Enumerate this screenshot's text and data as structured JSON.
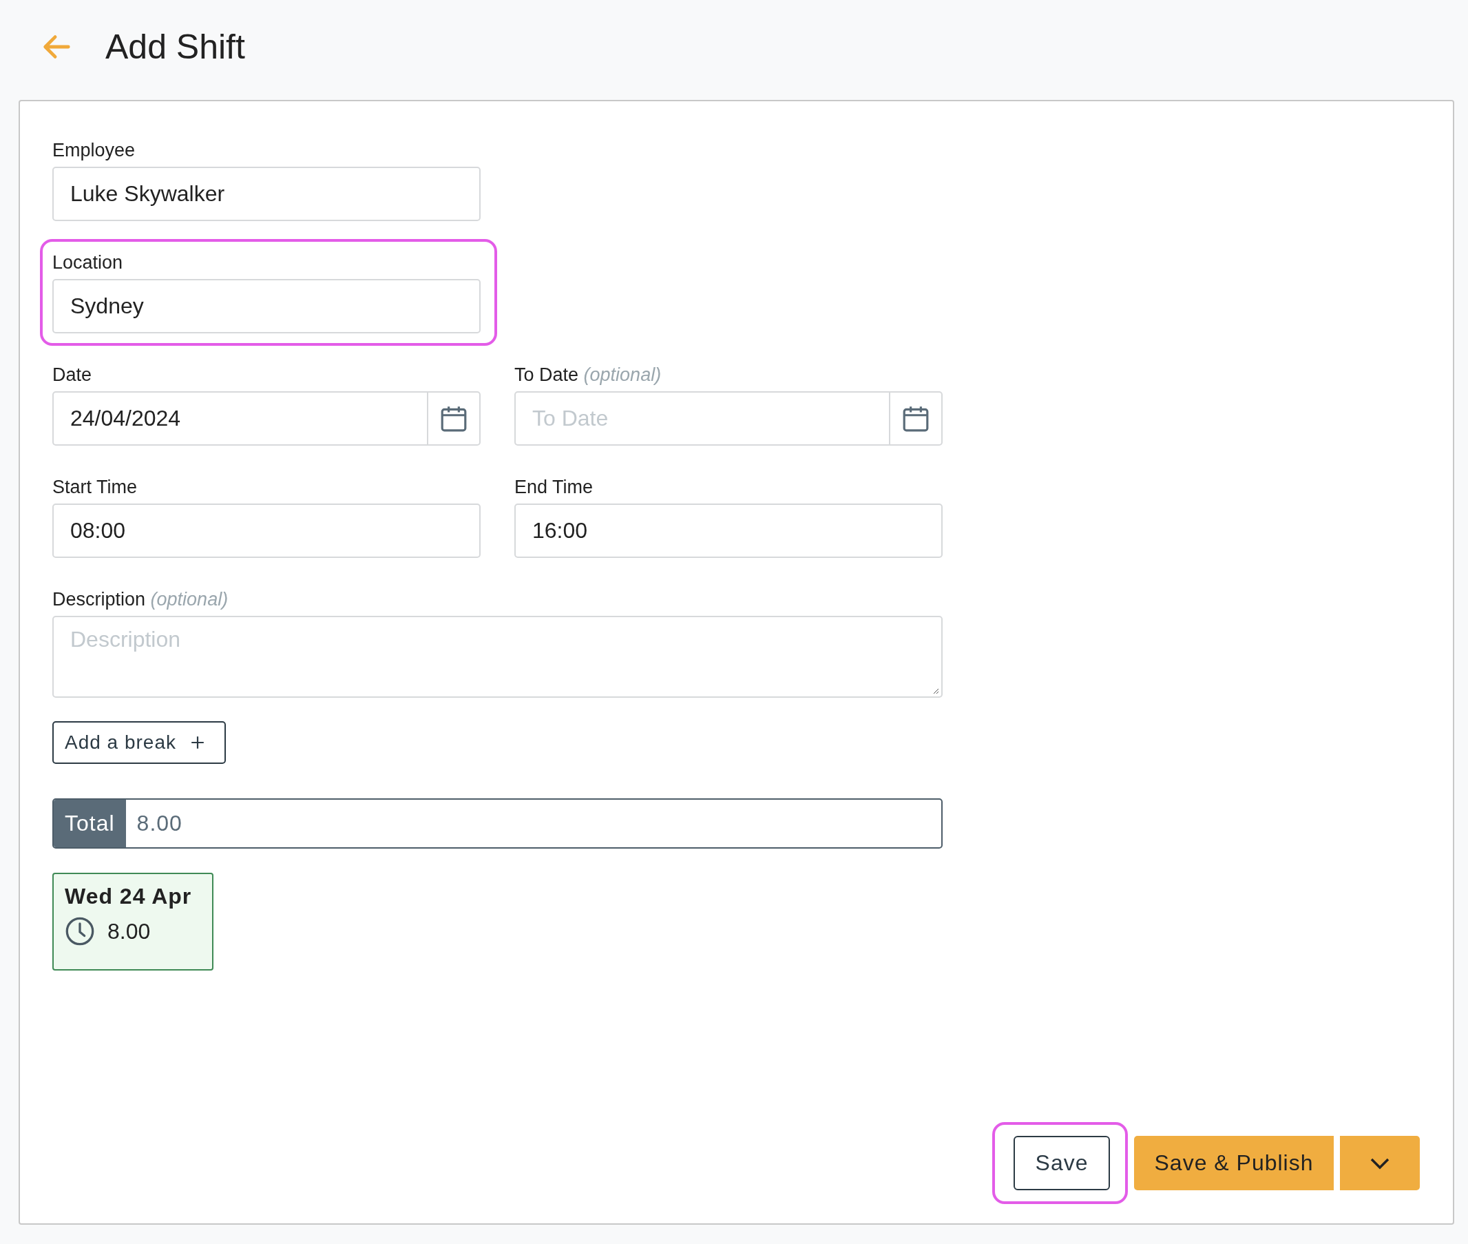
{
  "header": {
    "title": "Add Shift"
  },
  "form": {
    "rows": [
      [
        {
          "kind": "text",
          "label": "Employee",
          "value": "Luke Skywalker",
          "highlighted": false
        }
      ],
      [
        {
          "kind": "text",
          "label": "Location",
          "value": "Sydney",
          "highlighted": true
        }
      ],
      [
        {
          "kind": "date",
          "label": "Date",
          "value": "24/04/2024",
          "highlighted": false
        },
        {
          "kind": "date",
          "label": "To Date",
          "optional": "(optional)",
          "placeholder": "To Date",
          "highlighted": false
        }
      ],
      [
        {
          "kind": "text",
          "label": "Start Time",
          "value": "08:00",
          "highlighted": false
        },
        {
          "kind": "text",
          "label": "End Time",
          "value": "16:00",
          "highlighted": false
        }
      ],
      [
        {
          "kind": "textarea",
          "label": "Description",
          "optional": "(optional)",
          "placeholder": "Description",
          "highlighted": false
        }
      ]
    ]
  },
  "add_break": {
    "label": "Add a break"
  },
  "total": {
    "label": "Total",
    "value": "8.00"
  },
  "days": [
    {
      "day": "Wed 24 Apr",
      "hours": "8.00"
    }
  ],
  "actions": [
    {
      "kind": "secondary",
      "label": "Save",
      "highlighted": true
    },
    {
      "kind": "primary",
      "label": "Save & Publish",
      "highlighted": false
    },
    {
      "kind": "menu",
      "highlighted": false
    }
  ]
}
